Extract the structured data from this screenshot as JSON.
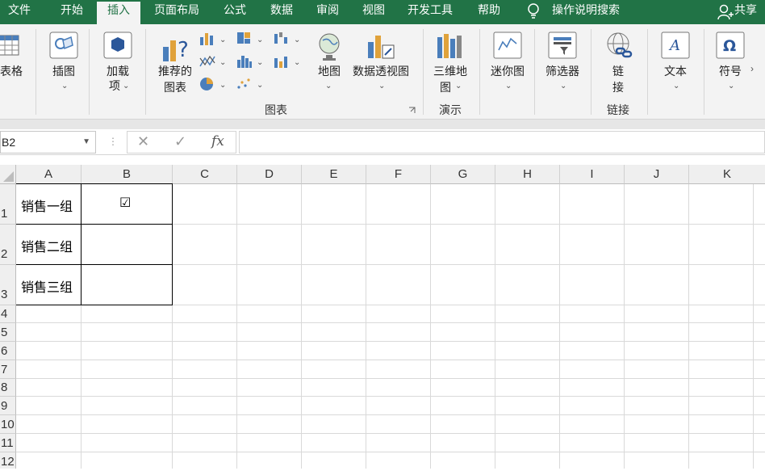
{
  "tabs": [
    {
      "label": "文件",
      "active": false
    },
    {
      "label": "开始",
      "active": false
    },
    {
      "label": "插入",
      "active": true
    },
    {
      "label": "页面布局",
      "active": false
    },
    {
      "label": "公式",
      "active": false
    },
    {
      "label": "数据",
      "active": false
    },
    {
      "label": "审阅",
      "active": false
    },
    {
      "label": "视图",
      "active": false
    },
    {
      "label": "开发工具",
      "active": false
    },
    {
      "label": "帮助",
      "active": false
    }
  ],
  "tell_me": "操作说明搜索",
  "share": "共享",
  "ribbon": {
    "table": {
      "label": "表格"
    },
    "illustrations": {
      "label": "插图",
      "dropdown": "⌄"
    },
    "addins": {
      "label_line1": "加载",
      "label_line2": "项"
    },
    "recommended_charts": {
      "label_line1": "推荐的",
      "label_line2": "图表"
    },
    "maps": {
      "label": "地图"
    },
    "pivot_chart": {
      "label": "数据透视图"
    },
    "charts_group": "图表",
    "map3d": {
      "label_line1": "三维地",
      "label_line2": "图"
    },
    "tours_group": "演示",
    "sparklines": {
      "label": "迷你图"
    },
    "filters": {
      "label": "筛选器"
    },
    "link": {
      "label_line1": "链",
      "label_line2": "接"
    },
    "links_group": "链接",
    "text": {
      "label": "文本"
    },
    "symbols": {
      "label": "符号"
    }
  },
  "formula_bar": {
    "name_box": "B2",
    "cancel": "✕",
    "enter": "✓",
    "fx": "fx",
    "value": ""
  },
  "columns": [
    "A",
    "B",
    "C",
    "D",
    "E",
    "F",
    "G",
    "H",
    "I",
    "J",
    "K"
  ],
  "rows": [
    "1",
    "2",
    "3",
    "4",
    "5",
    "6",
    "7",
    "8",
    "9",
    "10",
    "11",
    "12"
  ],
  "cells": {
    "A1": "销售一组",
    "A2": "销售二组",
    "A3": "销售三组",
    "B1": "☑"
  }
}
